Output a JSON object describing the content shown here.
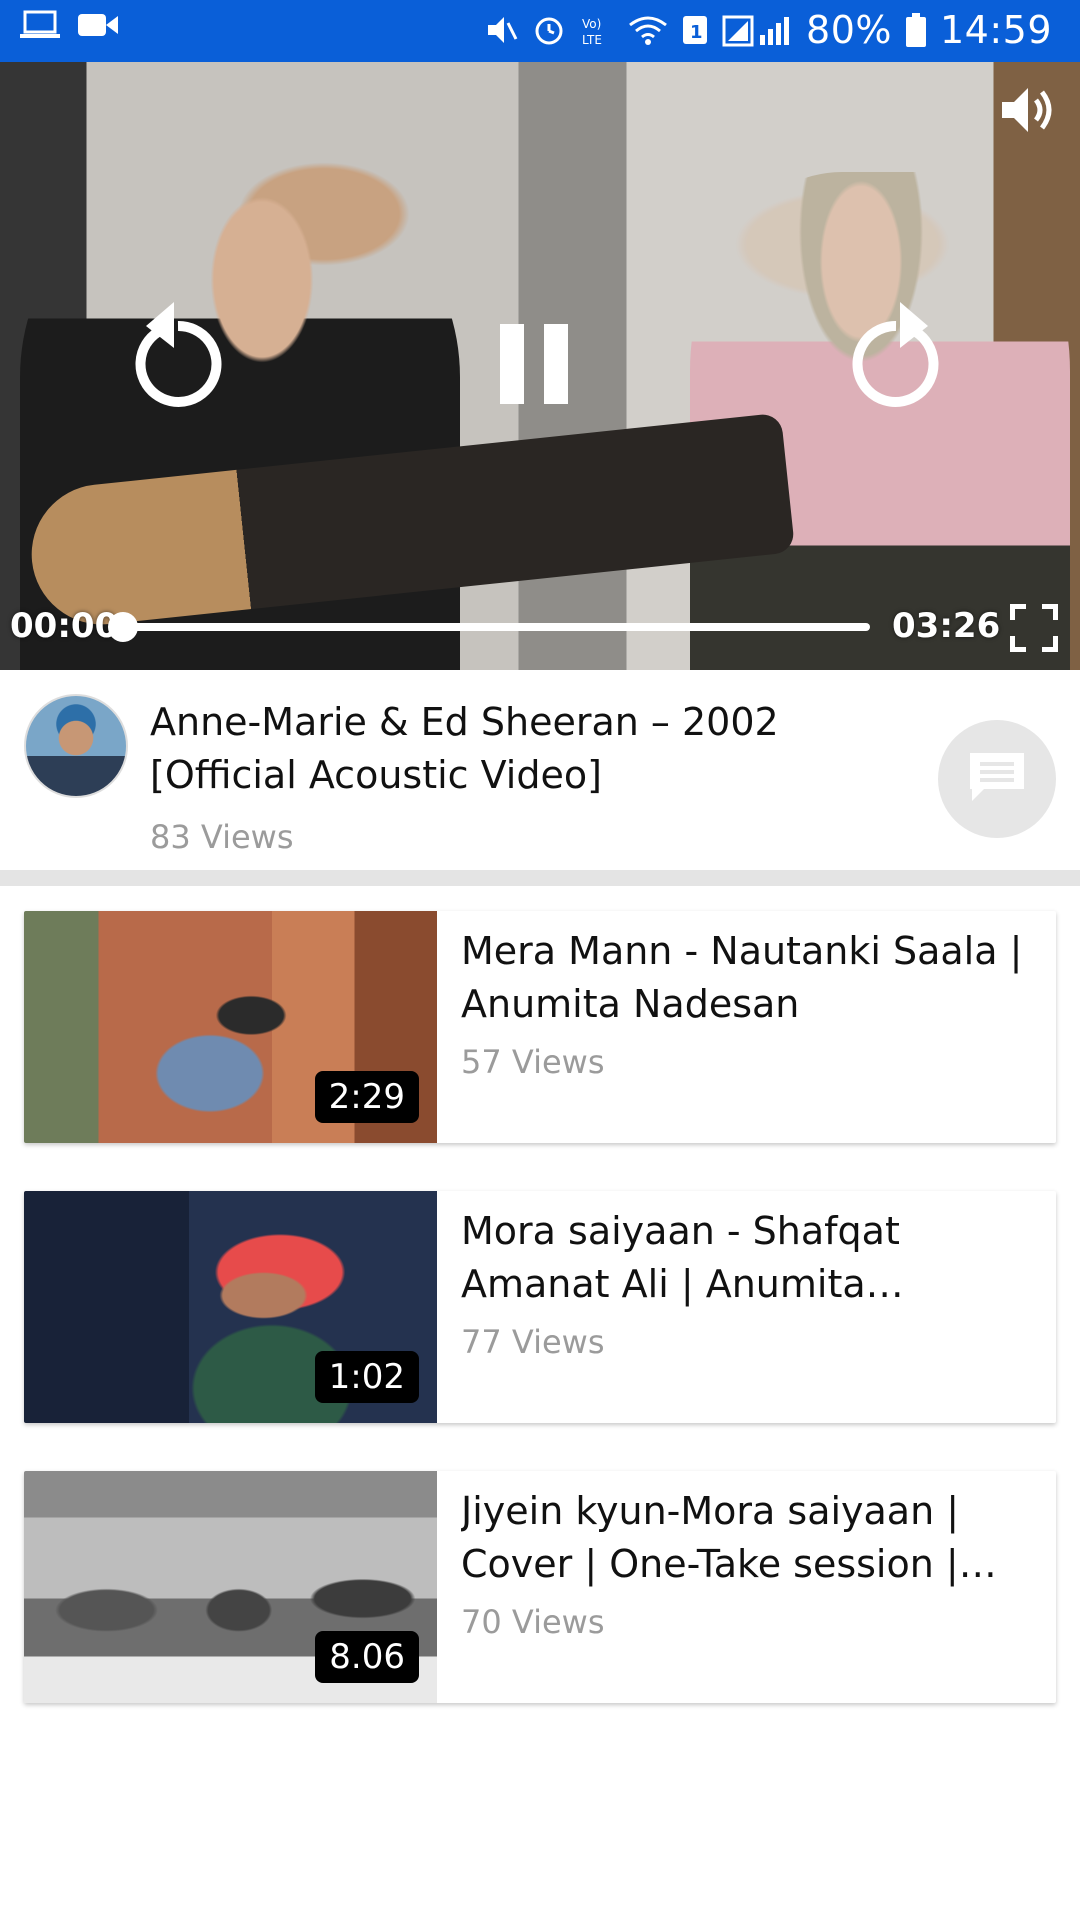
{
  "status_bar": {
    "battery": "80%",
    "time": "14:59",
    "sim_badge": "1",
    "icons": [
      "laptop-icon",
      "video-camera-icon",
      "mute-icon",
      "alarm-icon",
      "volte-icon",
      "wifi-icon",
      "signal-icon",
      "battery-icon"
    ],
    "color": "#0a5fd8"
  },
  "player": {
    "current_time": "00:00",
    "total_time": "03:26",
    "progress": 0.0,
    "icons": [
      "replay-icon",
      "pause-icon",
      "forward-icon",
      "volume-icon",
      "fullscreen-icon"
    ]
  },
  "now_playing": {
    "title": "Anne-Marie & Ed Sheeran – 2002 [Official Acoustic Video]",
    "views": "83 Views",
    "comment_icon": "comment-icon"
  },
  "related": [
    {
      "title": "Mera Mann - Nautanki Saala | Anumita Nadesan",
      "views": "57 Views",
      "duration": "2:29"
    },
    {
      "title": "Mora saiyaan - Shafqat Amanat Ali | Anumita Nadesan",
      "views": "77 Views",
      "duration": "1:02"
    },
    {
      "title": "Jiyein kyun-Mora saiyaan | Cover | One-Take session | Anumita Nadesan",
      "views": "70 Views",
      "duration": "8.06"
    }
  ]
}
